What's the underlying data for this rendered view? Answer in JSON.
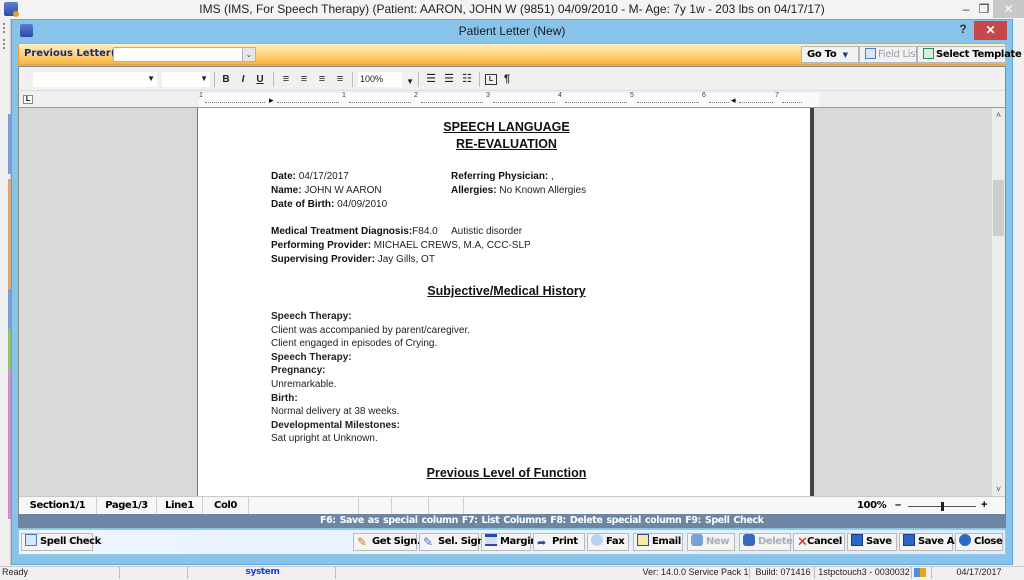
{
  "app": {
    "title": "IMS (IMS, For Speech Therapy)    (Patient: AARON, JOHN W (9851) 04/09/2010 - M- Age: 7y 1w - 203 lbs on 04/17/17)",
    "minimize_glyph": "–",
    "restore_glyph": "❐",
    "close_glyph": "✕"
  },
  "dialog": {
    "title": "Patient Letter (New)",
    "help_glyph": "?",
    "close_glyph": "✕"
  },
  "letter_bar": {
    "previous_letters_label": "Previous Letter(s):",
    "previous_letters_value": "",
    "goto_label": "Go To",
    "goto_arrow": "▼",
    "field_list_label": "Field List",
    "select_template_label": "Select Template"
  },
  "format_toolbar": {
    "font_value": "",
    "size_value": "",
    "bold": "B",
    "italic": "I",
    "underline": "U",
    "zoom_value": "100%",
    "combo_arrow": "▼",
    "pilcrow": "¶"
  },
  "ruler": {
    "corner": "L",
    "marks": [
      "1",
      "1",
      "2",
      "3",
      "4",
      "5",
      "6",
      "7"
    ]
  },
  "document": {
    "title_line1": "SPEECH LANGUAGE ",
    "title_line2": "RE-EVALUATION",
    "date_label": "Date:",
    "date_value": " 04/17/2017",
    "name_label": "Name:",
    "name_value": " JOHN W AARON",
    "dob_label": "Date of Birth:",
    "dob_value": " 04/09/2010",
    "ref_phys_label": "Referring Physician:",
    "ref_phys_value": " ,",
    "allergies_label": "Allergies:",
    "allergies_value": " No Known Allergies",
    "diagnosis_label": "Medical Treatment Diagnosis:",
    "diagnosis_code": "F84.0",
    "diagnosis_desc": "Autistic disorder",
    "performing_label": "Performing Provider:",
    "performing_value": " MICHAEL CREWS, M.A, CCC-SLP",
    "supervising_label": "Supervising Provider:",
    "supervising_value": " Jay Gills, OT",
    "section1_heading": "Subjective/Medical History",
    "section1_lines": [
      {
        "text": "Speech Therapy:",
        "bold": true
      },
      {
        "text": "Client was accompanied by parent/caregiver.",
        "bold": false
      },
      {
        "text": "Client engaged in episodes of Crying.",
        "bold": false
      },
      {
        "text": "Speech Therapy:",
        "bold": true
      },
      {
        "text": "Pregnancy:",
        "bold": true
      },
      {
        "text": "Unremarkable.",
        "bold": false
      },
      {
        "text": "Birth:",
        "bold": true
      },
      {
        "text": "Normal delivery at 38 weeks.",
        "bold": false
      },
      {
        "text": "Developmental Milestones:",
        "bold": true
      },
      {
        "text": "Sat upright at Unknown.",
        "bold": false
      }
    ],
    "section2_heading": "Previous Level of Function"
  },
  "scrollbar": {
    "up_glyph": "˄",
    "down_glyph": "˅",
    "position_fraction": 0.2
  },
  "editor_status": {
    "section": "Section1/1",
    "page": "Page1/3",
    "line": "Line1",
    "col": "Col0",
    "zoom": "100%",
    "zoom_minus": "–",
    "zoom_plus": "+",
    "zoom_level_fraction": 0.5
  },
  "hotkeys": "F6: Save as special column   F7: List Columns   F8: Delete special column   F9:  Spell Check",
  "actions": {
    "spell_check": "Spell Check",
    "get_sign": "Get Sign.",
    "sel_sign": "Sel. Sign.",
    "margin": "Margin",
    "print": "Print",
    "fax": "Fax",
    "email": "Email",
    "new": "New",
    "delete": "Delete",
    "cancel": "Cancel",
    "save": "Save",
    "save_as": "Save As",
    "close": "Close"
  },
  "status_bar": {
    "state": "Ready",
    "user": "system",
    "version": "Ver: 14.0.0 Service Pack 1",
    "build": "Build: 071416",
    "station": "1stpctouch3 - 0030032",
    "date": "04/17/2017"
  },
  "colors": {
    "dialog_frame": "#88c4ea",
    "orange_bar": "#f7b640",
    "hotkey_bar": "#6c86a4",
    "close_red": "#c74848",
    "user_blue": "#1a3ad8"
  }
}
